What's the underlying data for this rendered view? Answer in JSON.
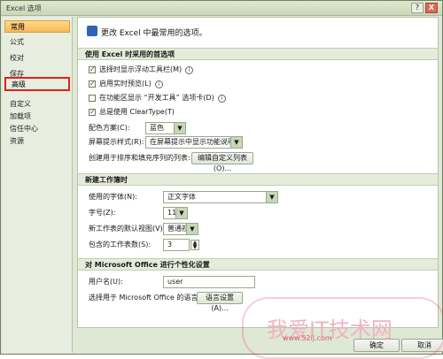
{
  "window": {
    "title": "Excel 选项",
    "help_label": "?",
    "close_label": "X"
  },
  "sidebar": {
    "items": [
      {
        "label": "常用",
        "active": true
      },
      {
        "label": "公式"
      },
      {
        "label": "校对"
      },
      {
        "label": "保存"
      },
      {
        "label": "高级",
        "highlight": true
      },
      {
        "label": "自定义"
      },
      {
        "label": "加载项"
      },
      {
        "label": "信任中心"
      },
      {
        "label": "资源"
      }
    ]
  },
  "content": {
    "intro": "更改 Excel 中最常用的选项。",
    "sections": {
      "top_options": {
        "title": "使用 Excel 时采用的首选项",
        "checkboxes": [
          {
            "label": "选择时显示浮动工具栏(M)",
            "checked": true
          },
          {
            "label": "启用实时预览(L)",
            "checked": true
          },
          {
            "label": "在功能区显示 “开发工具” 选项卡(D)",
            "checked": false
          },
          {
            "label": "总是使用 ClearType(T)",
            "checked": true
          }
        ],
        "color_scheme_label": "配色方案(C):",
        "color_scheme_value": "蓝色",
        "tooltip_style_label": "屏幕提示样式(R):",
        "tooltip_style_value": "在屏幕提示中显示功能说明",
        "custom_lists_label": "创建用于排序和填充序列的列表:",
        "custom_lists_button": "编辑自定义列表(O)..."
      },
      "new_workbook": {
        "title": "新建工作簿时",
        "font_label": "使用的字体(N):",
        "font_value": "正文字体",
        "size_label": "字号(Z):",
        "size_value": "11",
        "view_label": "新工作表的默认视图(V):",
        "view_value": "普通视图",
        "sheets_label": "包含的工作表数(S):",
        "sheets_value": "3"
      },
      "personalize": {
        "title": "对 Microsoft Office 进行个性化设置",
        "username_label": "用户名(U):",
        "username_value": "user",
        "language_label": "选择用于 Microsoft Office 的语言:",
        "language_button": "语言设置(A)..."
      }
    }
  },
  "footer": {
    "ok_label": "确定",
    "cancel_label": "取消"
  },
  "watermark": {
    "text": "我爱IT技术网",
    "url": "www.52ij.com"
  }
}
